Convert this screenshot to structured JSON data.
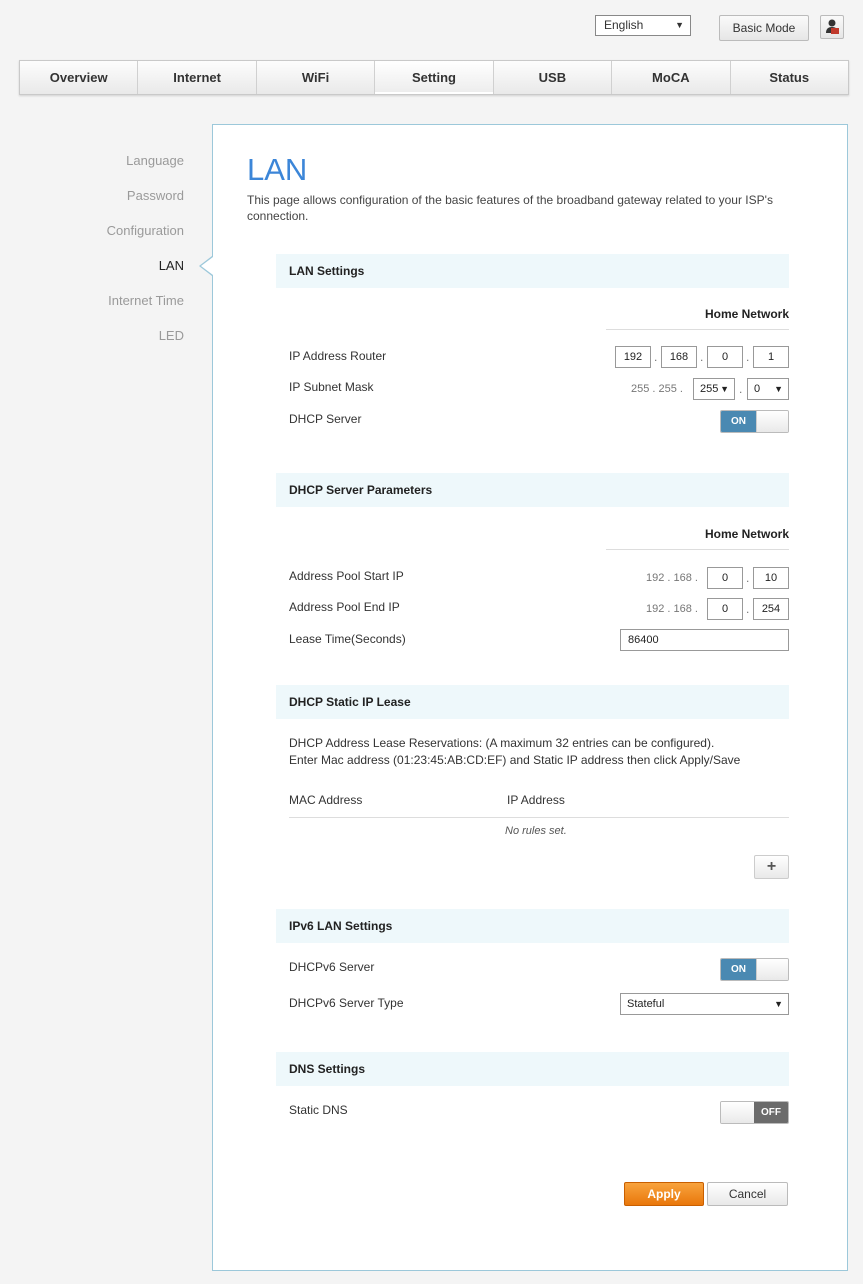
{
  "top": {
    "language": "English",
    "basic_mode": "Basic Mode",
    "user_icon": "user-icon"
  },
  "tabs": [
    "Overview",
    "Internet",
    "WiFi",
    "Setting",
    "USB",
    "MoCA",
    "Status"
  ],
  "active_tab": "Setting",
  "sidebar": [
    "Language",
    "Password",
    "Configuration",
    "LAN",
    "Internet Time",
    "LED"
  ],
  "active_sidebar": "LAN",
  "page": {
    "title": "LAN",
    "description": "This page allows configuration of the basic features of the broadband gateway related to your ISP's connection."
  },
  "lan_settings": {
    "heading": "LAN Settings",
    "column": "Home Network",
    "ip_router_label": "IP Address Router",
    "ip_router": [
      "192",
      "168",
      "0",
      "1"
    ],
    "subnet_label": "IP Subnet Mask",
    "subnet_fixed": "255 . 255 .",
    "subnet_select3": "255",
    "subnet_select4": "0",
    "dhcp_label": "DHCP Server",
    "dhcp_state": "ON"
  },
  "dhcp_params": {
    "heading": "DHCP Server Parameters",
    "column": "Home Network",
    "start_label": "Address Pool Start IP",
    "start_prefix": "192 . 168 .",
    "start_3": "0",
    "start_4": "10",
    "end_label": "Address Pool End IP",
    "end_prefix": "192 . 168 .",
    "end_3": "0",
    "end_4": "254",
    "lease_label": "Lease Time(Seconds)",
    "lease_value": "86400"
  },
  "static_lease": {
    "heading": "DHCP Static IP Lease",
    "note1": "DHCP Address Lease Reservations: (A maximum 32 entries can be configured).",
    "note2": "Enter Mac address (01:23:45:AB:CD:EF) and Static IP address then click Apply/Save",
    "col_mac": "MAC Address",
    "col_ip": "IP Address",
    "empty": "No rules set.",
    "add_label": "+"
  },
  "ipv6": {
    "heading": "IPv6 LAN Settings",
    "server_label": "DHCPv6 Server",
    "server_state": "ON",
    "type_label": "DHCPv6 Server Type",
    "type_value": "Stateful"
  },
  "dns": {
    "heading": "DNS Settings",
    "static_label": "Static DNS",
    "static_state": "OFF"
  },
  "actions": {
    "apply": "Apply",
    "cancel": "Cancel"
  },
  "colors": {
    "title_blue": "#3c86d8",
    "toggle_on": "#4a89b2",
    "apply_orange": "#e9770b",
    "panel_border": "#9cc8da",
    "section_bg": "#eef8fb"
  }
}
